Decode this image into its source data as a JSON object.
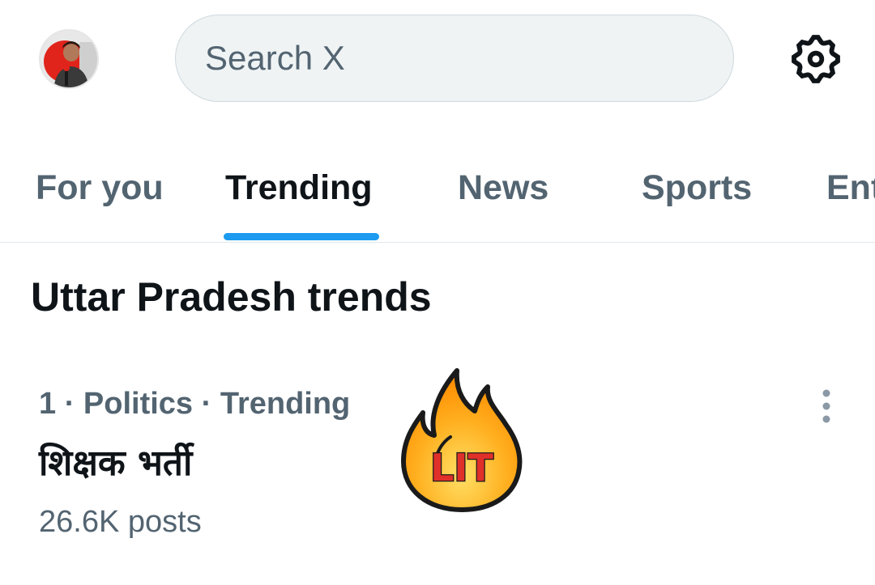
{
  "search": {
    "placeholder": "Search X",
    "value": ""
  },
  "icons": {
    "avatar": "profile-avatar",
    "settings": "gear-icon",
    "more": "more-vertical-icon",
    "sticker": "lit-fire-sticker"
  },
  "tabs": [
    {
      "label": "For you",
      "active": false
    },
    {
      "label": "Trending",
      "active": true
    },
    {
      "label": "News",
      "active": false
    },
    {
      "label": "Sports",
      "active": false
    },
    {
      "label": "Ent",
      "active": false
    }
  ],
  "section": {
    "title": "Uttar Pradesh trends"
  },
  "trends": [
    {
      "meta": "1 · Politics · Trending",
      "title": "शिक्षक भर्ती",
      "count": "26.6K posts",
      "sticker_text": "LIT"
    }
  ],
  "colors": {
    "accent": "#1d9bf0",
    "text_primary": "#0f1419",
    "text_secondary": "#536471",
    "search_bg": "#eff3f4"
  }
}
